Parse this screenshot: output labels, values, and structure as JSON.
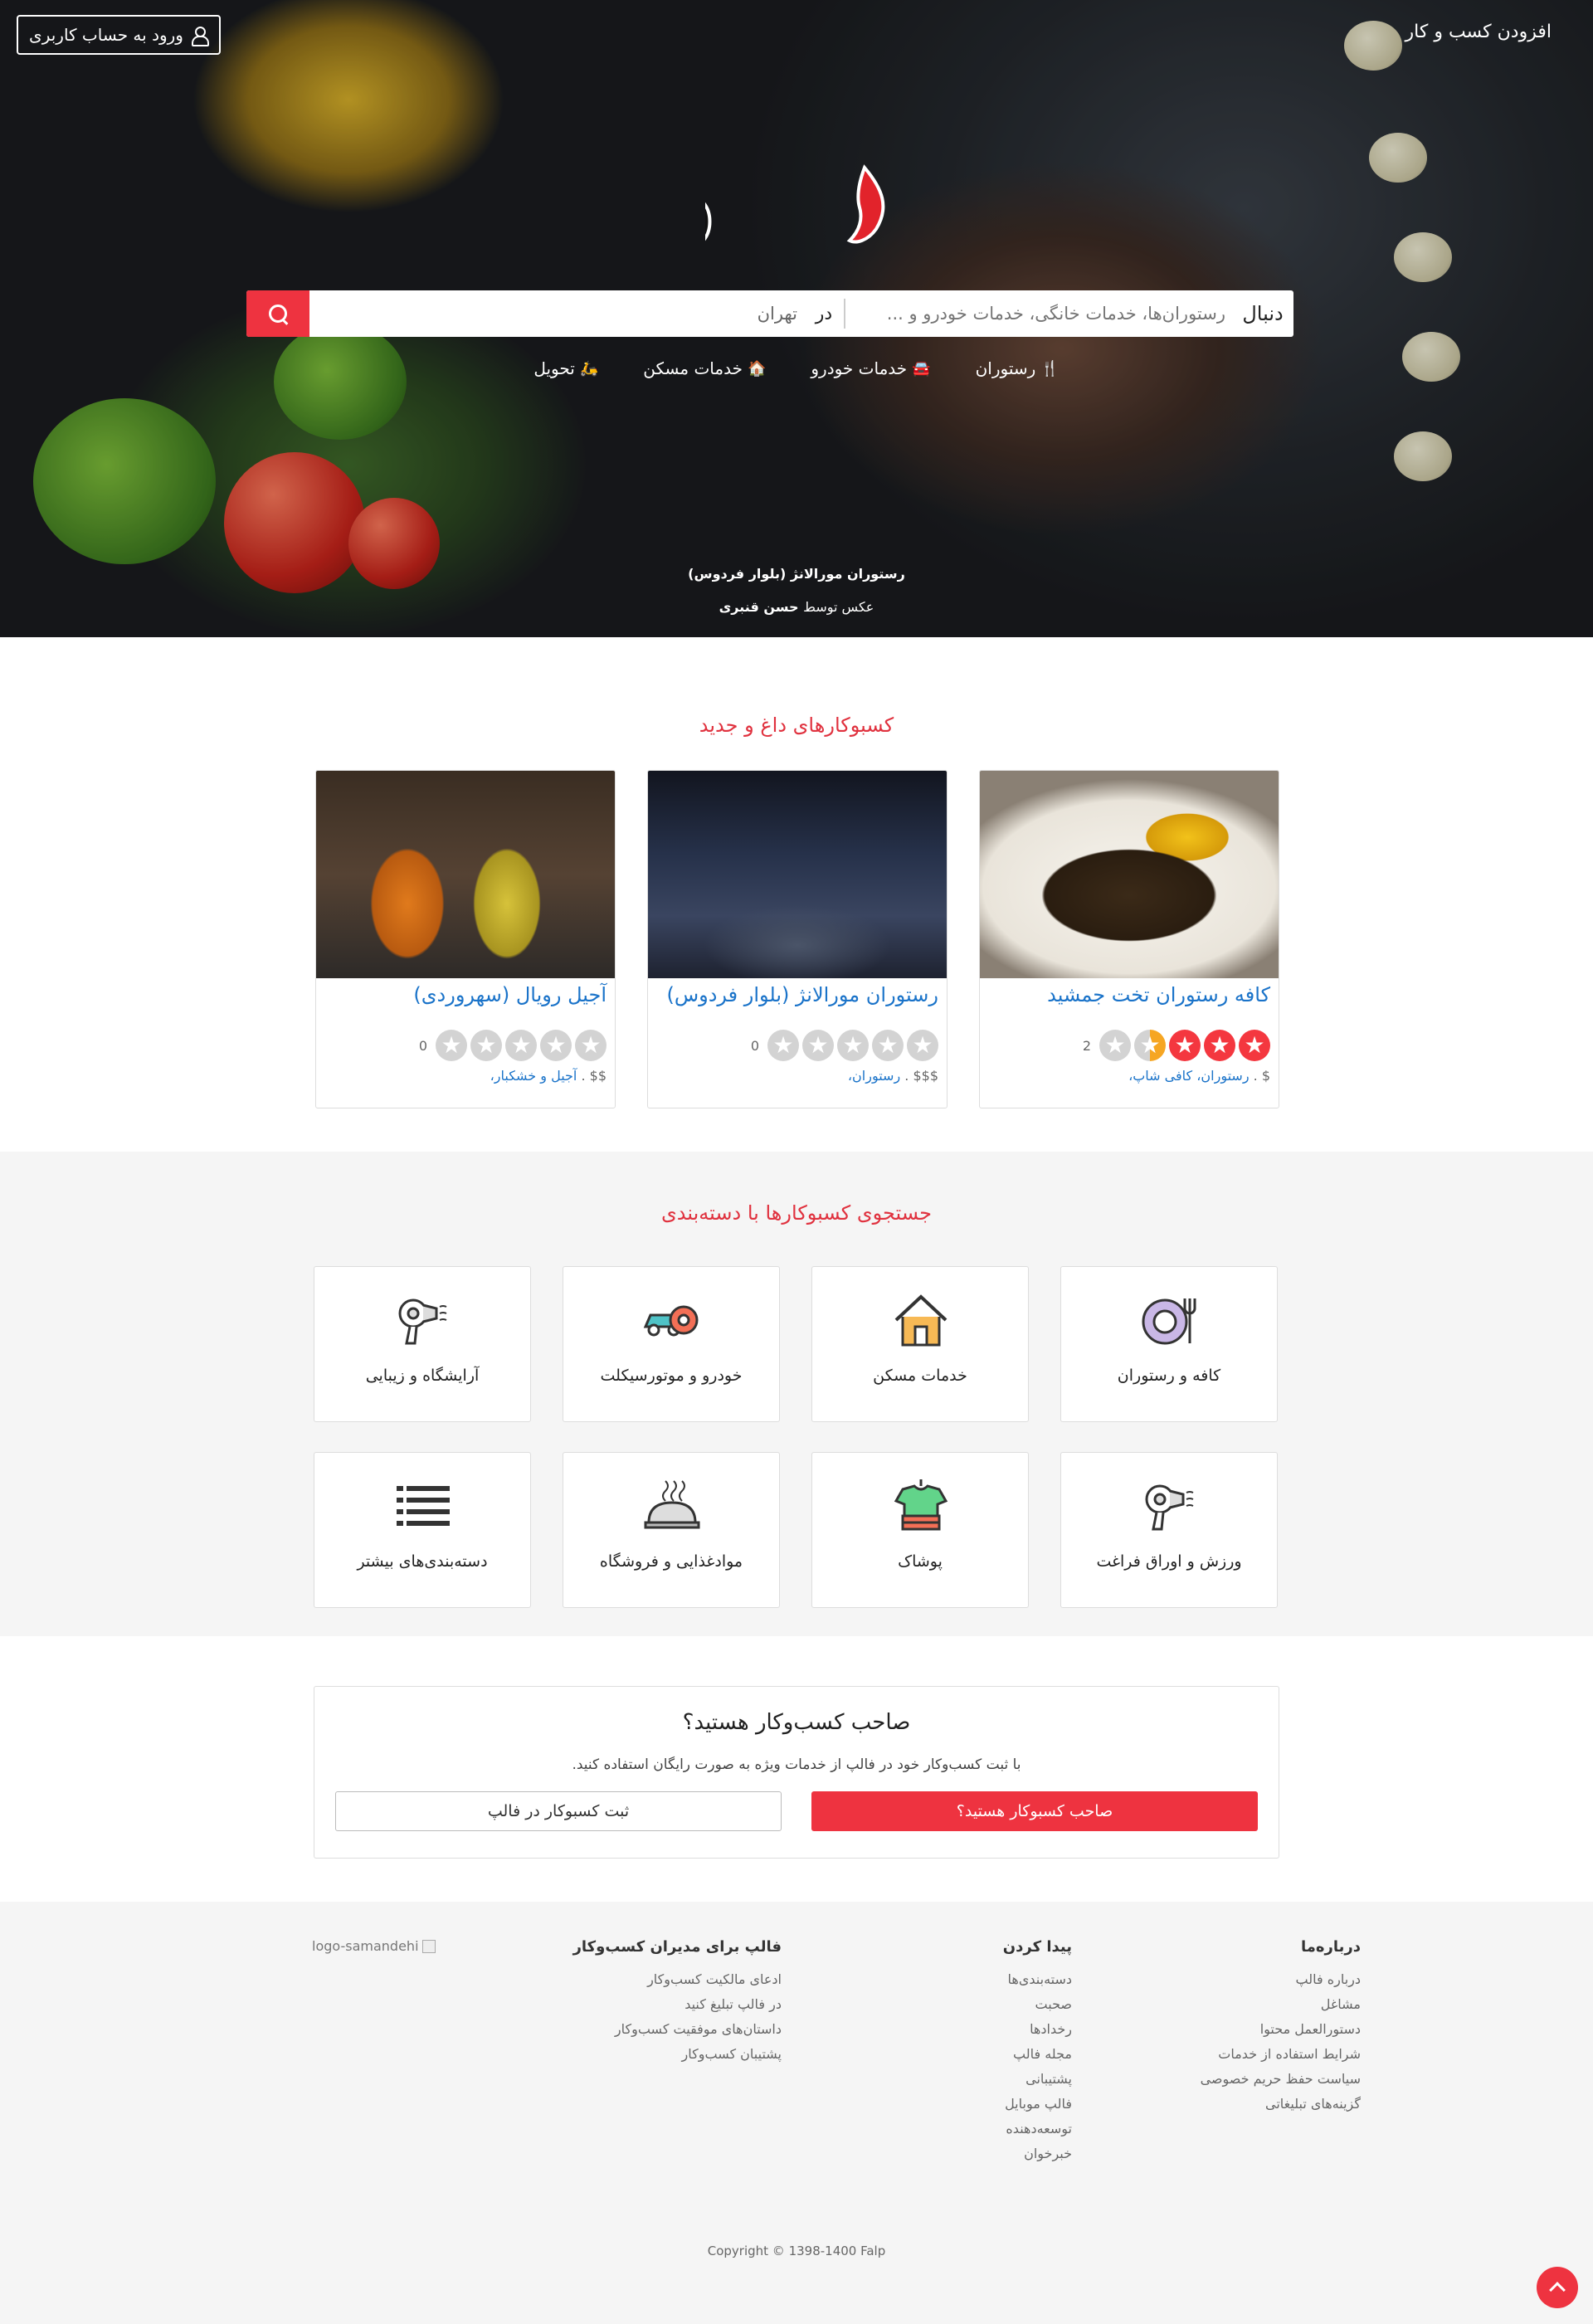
{
  "header": {
    "add_business": "افزودن کسب و کار",
    "login": "ورود به حساب کاربری",
    "logo_text": "falp"
  },
  "search": {
    "find_label": "دنبال",
    "find_placeholder": "رستوران‌ها، خدمات خانگی، خدمات خودرو و ...",
    "near_label": "در",
    "near_value": "تهران"
  },
  "quick_links": [
    {
      "label": "رستوران",
      "icon": "fork-knife-icon"
    },
    {
      "label": "خدمات خودرو",
      "icon": "car-icon"
    },
    {
      "label": "خدمات مسکن",
      "icon": "home-icon"
    },
    {
      "label": "تحویل",
      "icon": "scooter-icon"
    }
  ],
  "hero_caption": {
    "place": "رستوران مورالانژ (بلوار فردوس)",
    "credit_prefix": "عکس توسط",
    "credit_name": "حسن قنبری"
  },
  "hot": {
    "title": "کسبوکارهای داغ و جدید",
    "cards": [
      {
        "name": "کافه رستوران تخت جمشید",
        "rating": 3,
        "count": "2",
        "price": "$",
        "categories": "رستوران، کافی شاپ،"
      },
      {
        "name": "رستوران مورالانژ (بلوار فردوس)",
        "rating": 0,
        "count": "0",
        "price": "$$$",
        "categories": "رستوران،"
      },
      {
        "name": "آجیل رویال (سهروردی)",
        "rating": 0,
        "count": "0",
        "price": "$$",
        "categories": "آجیل و خشکبار،"
      }
    ]
  },
  "categories": {
    "title": "جستجوی کسبوکارها با دسته‌بندی",
    "items": [
      {
        "label": "کافه و رستوران",
        "icon": "plate-fork-icon"
      },
      {
        "label": "خدمات مسکن",
        "icon": "house-icon"
      },
      {
        "label": "خودرو و موتورسیکلت",
        "icon": "car-gear-icon"
      },
      {
        "label": "آرایشگاه و زیبایی",
        "icon": "hair-dryer-icon"
      },
      {
        "label": "ورزش و اوراق فراغت",
        "icon": "hair-dryer-icon"
      },
      {
        "label": "پوشاک",
        "icon": "shirt-icon"
      },
      {
        "label": "موادغذایی و فروشگاه",
        "icon": "food-cloche-icon"
      },
      {
        "label": "دسته‌بندی‌های بیشتر",
        "icon": "list-icon"
      }
    ]
  },
  "owner": {
    "title": "صاحب کسب‌وکار هستید؟",
    "text": "با ثبت کسب‌وکار خود در فالپ از خدمات ویژه به صورت رایگان استفاده کنید.",
    "primary_button": "صاحب کسبوکار هستید؟",
    "secondary_button": "ثبت کسبوکار در فالپ"
  },
  "footer": {
    "about": {
      "title": "درباره‌ما",
      "links": [
        "درباره فالپ",
        "مشاغل",
        "دستورالعمل محتوا",
        "شرایط استفاده از خدمات",
        "سیاست حفظ حریم خصوصی",
        "گزینه‌های تبلیغاتی"
      ]
    },
    "discover": {
      "title": "پیدا کردن",
      "links": [
        "دسته‌بندی‌ها",
        "صحبت",
        "رخدادها",
        "مجله فالپ",
        "پشتیبانی",
        "فالپ موبایل",
        "توسعه‌دهنده",
        "خبرخوان"
      ]
    },
    "business": {
      "title": "فالپ برای مدیران کسب‌وکار",
      "links": [
        "ادعای مالکیت کسب‌وکار",
        "در فالپ تبلیغ کنید",
        "داستان‌های موفقیت کسب‌وکار",
        "پشتیبان کسب‌وکار"
      ]
    },
    "samandehi_alt": "logo-samandehi",
    "copyright": "Copyright © 1398-1400 Falp"
  },
  "colors": {
    "brand_red": "#ee3340",
    "link_blue": "#1a73c9",
    "title_red": "#e0313e",
    "star_red": "#f4373f",
    "star_orange": "#f6a623"
  }
}
